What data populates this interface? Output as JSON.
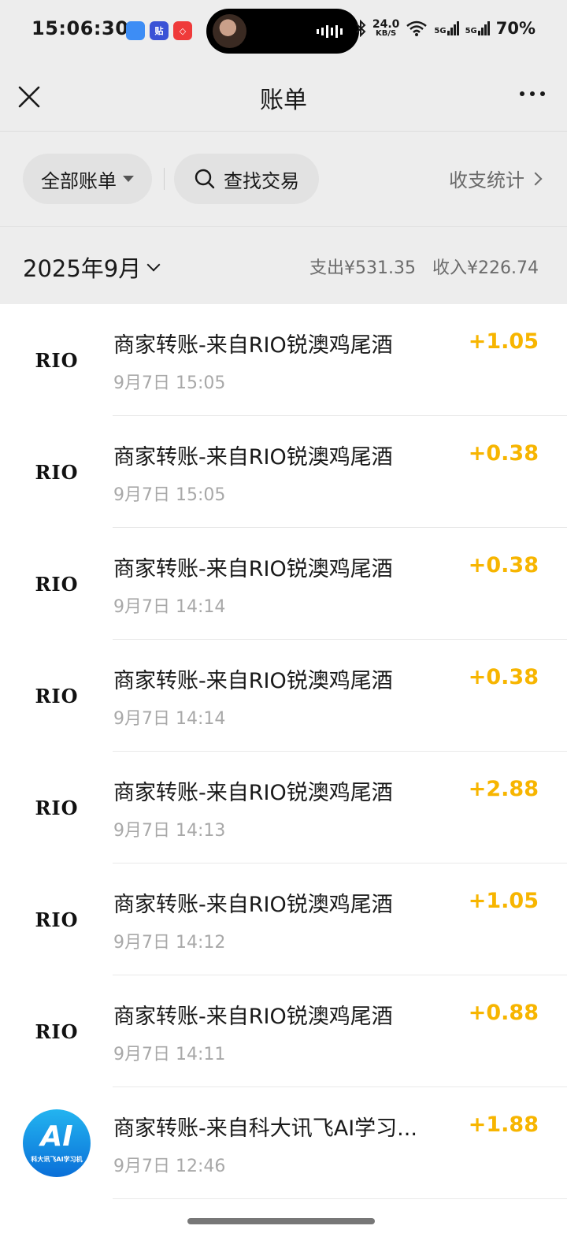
{
  "status_bar": {
    "time": "15:06:30",
    "app_icons": [
      {
        "name": "blue-app-icon",
        "color": "#3d8df5",
        "glyph": ""
      },
      {
        "name": "tie-app-icon",
        "color": "#3a52d6",
        "glyph": "贴"
      },
      {
        "name": "red-app-icon",
        "color": "#ef3a3a",
        "glyph": "◇"
      }
    ],
    "net_speed_value": "24.0",
    "net_speed_unit": "KB/S",
    "signal_1": "5G",
    "signal_2": "5G",
    "battery": "70%"
  },
  "nav": {
    "title": "账单"
  },
  "filters": {
    "all_bills": "全部账单",
    "search": "查找交易",
    "stats": "收支统计"
  },
  "month": {
    "label": "2025年9月",
    "expense": "支出¥531.35",
    "income": "收入¥226.74"
  },
  "colors": {
    "amount": "#f7b500",
    "background": "#ededed"
  },
  "transactions": [
    {
      "logo": "rio-logo",
      "logo_text": "RIO",
      "title": "商家转账-来自RIO锐澳鸡尾酒",
      "date": "9月7日 15:05",
      "amount": "+1.05"
    },
    {
      "logo": "rio-logo",
      "logo_text": "RIO",
      "title": "商家转账-来自RIO锐澳鸡尾酒",
      "date": "9月7日 15:05",
      "amount": "+0.38"
    },
    {
      "logo": "rio-logo",
      "logo_text": "RIO",
      "title": "商家转账-来自RIO锐澳鸡尾酒",
      "date": "9月7日 14:14",
      "amount": "+0.38"
    },
    {
      "logo": "rio-logo",
      "logo_text": "RIO",
      "title": "商家转账-来自RIO锐澳鸡尾酒",
      "date": "9月7日 14:14",
      "amount": "+0.38"
    },
    {
      "logo": "rio-logo",
      "logo_text": "RIO",
      "title": "商家转账-来自RIO锐澳鸡尾酒",
      "date": "9月7日 14:13",
      "amount": "+2.88"
    },
    {
      "logo": "rio-logo",
      "logo_text": "RIO",
      "title": "商家转账-来自RIO锐澳鸡尾酒",
      "date": "9月7日 14:12",
      "amount": "+1.05"
    },
    {
      "logo": "rio-logo",
      "logo_text": "RIO",
      "title": "商家转账-来自RIO锐澳鸡尾酒",
      "date": "9月7日 14:11",
      "amount": "+0.88"
    },
    {
      "logo": "ai-logo",
      "logo_text": "AI",
      "logo_subtext": "科大讯飞AI学习机",
      "title": "商家转账-来自科大讯飞AI学习...",
      "date": "9月7日 12:46",
      "amount": "+1.88"
    }
  ]
}
